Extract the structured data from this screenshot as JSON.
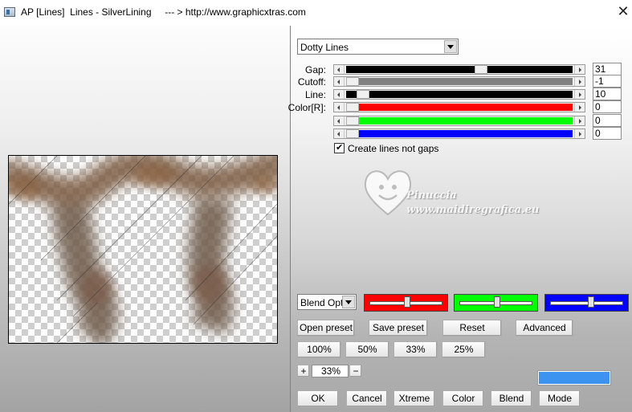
{
  "window": {
    "title": "AP [Lines]  Lines - SilverLining     --- > http://www.graphicxtras.com"
  },
  "effect_select": {
    "value": "Dotty Lines"
  },
  "sliders": [
    {
      "label": "Gap:",
      "value": "31",
      "fraction": 0.6,
      "color": "#000000"
    },
    {
      "label": "Cutoff:",
      "value": "-1",
      "fraction": 0.0,
      "color": "#808080"
    },
    {
      "label": "Line:",
      "value": "10",
      "fraction": 0.05,
      "color": "#000000"
    },
    {
      "label": "Color[R]:",
      "value": "0",
      "fraction": 0.0,
      "color": "#ff0000"
    },
    {
      "label": "",
      "value": "0",
      "fraction": 0.0,
      "color": "#00ff00"
    },
    {
      "label": "",
      "value": "0",
      "fraction": 0.0,
      "color": "#0000ff"
    }
  ],
  "options": {
    "create_lines_label": "Create lines not gaps",
    "create_lines_checked": true
  },
  "blend": {
    "value": "Blend Optic",
    "color_sliders": [
      {
        "color": "#ff0000",
        "position": 0.5
      },
      {
        "color": "#00ff00",
        "position": 0.5
      },
      {
        "color": "#0000ff",
        "position": 0.55
      }
    ]
  },
  "preset_buttons": [
    "Open preset",
    "Save preset",
    "Reset",
    "Advanced"
  ],
  "zoom_buttons": [
    "100%",
    "50%",
    "33%",
    "25%"
  ],
  "zoom": {
    "plus": "+",
    "value": "33%",
    "minus": "−"
  },
  "accent_color": "#3c94f0",
  "bottom_buttons": [
    "OK",
    "Cancel",
    "Xtreme",
    "Color",
    "Blend",
    "Mode"
  ],
  "watermark": {
    "name": "Pinuccia",
    "url": "www.maidiregrafica.eu"
  }
}
